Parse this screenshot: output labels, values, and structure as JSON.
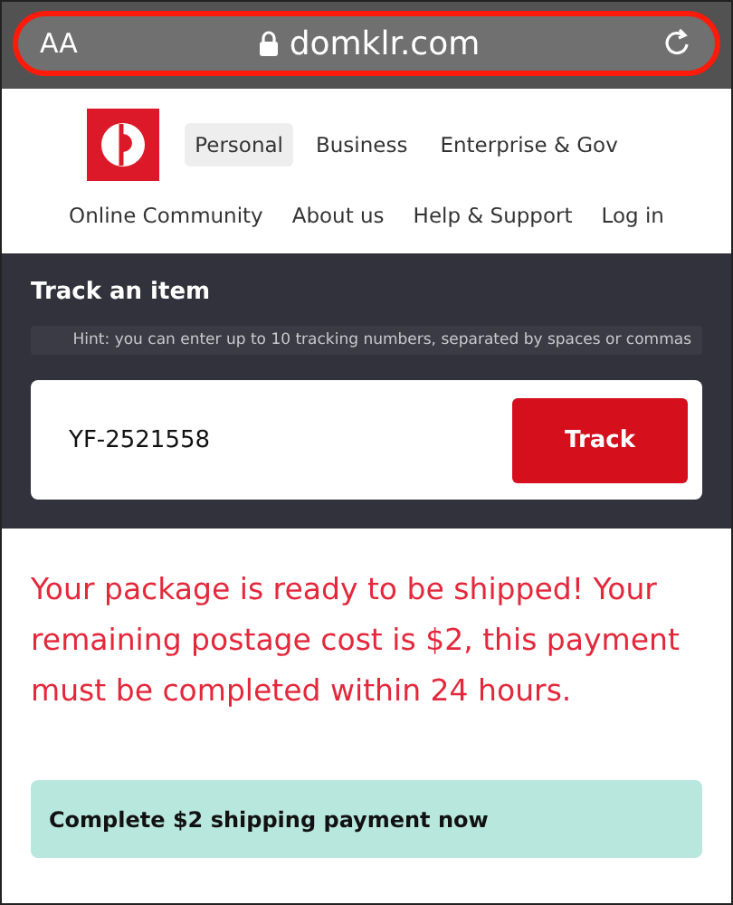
{
  "browser_bar": {
    "text_size_label": "AA",
    "url": "domklr.com",
    "highlighted": true
  },
  "primary_nav": [
    {
      "label": "Personal",
      "selected": true
    },
    {
      "label": "Business",
      "selected": false
    },
    {
      "label": "Enterprise & Gov",
      "selected": false
    }
  ],
  "secondary_nav": [
    "Online Community",
    "About us",
    "Help & Support",
    "Log in"
  ],
  "tracking": {
    "title": "Track an item",
    "hint": "Hint: you can enter up to 10 tracking numbers, separated by spaces or commas",
    "value": "YF-2521558",
    "button": "Track"
  },
  "message": "Your package is ready to be shipped! Your remaining postage cost is $2, this payment must be completed within 24 hours.",
  "pay_button": "Complete $2 shipping payment now"
}
